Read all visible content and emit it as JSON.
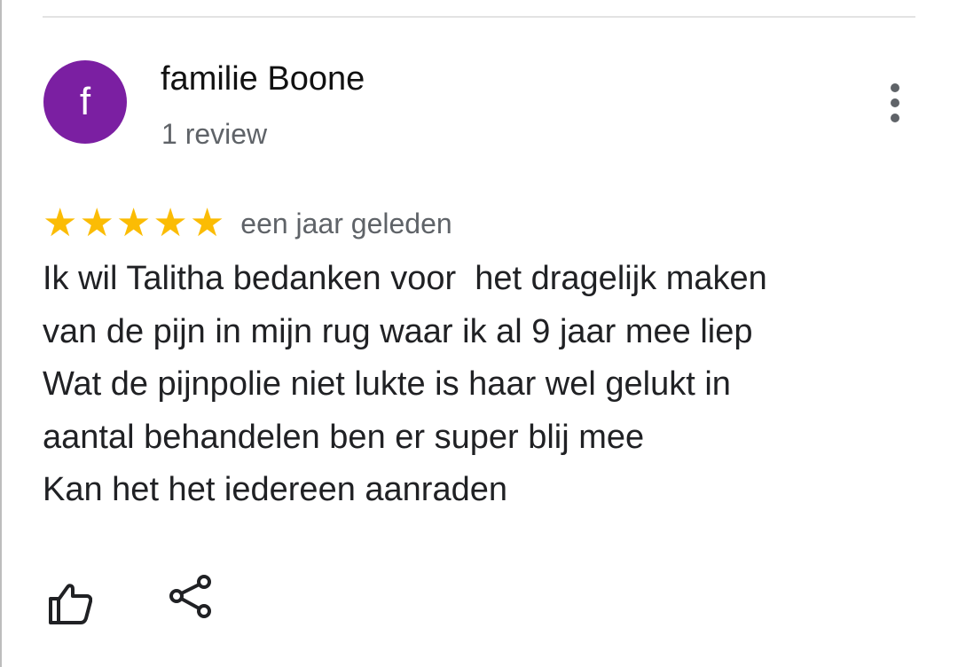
{
  "review": {
    "avatar_letter": "f",
    "avatar_color": "#7b1fa2",
    "author_name": "familie Boone",
    "author_meta": "1 review",
    "rating": 5,
    "rating_max": 5,
    "star_color": "#fbbc04",
    "date": "een jaar geleden",
    "text": "Ik wil Talitha bedanken voor  het dragelijk maken\nvan de pijn in mijn rug waar ik al 9 jaar mee liep\nWat de pijnpolie niet lukte is haar wel gelukt in\naantal behandelen ben er super blij mee\nKan het het iedereen aanraden"
  },
  "icons": {
    "more": "more-vert-icon",
    "like": "thumb-up-icon",
    "share": "share-icon"
  }
}
